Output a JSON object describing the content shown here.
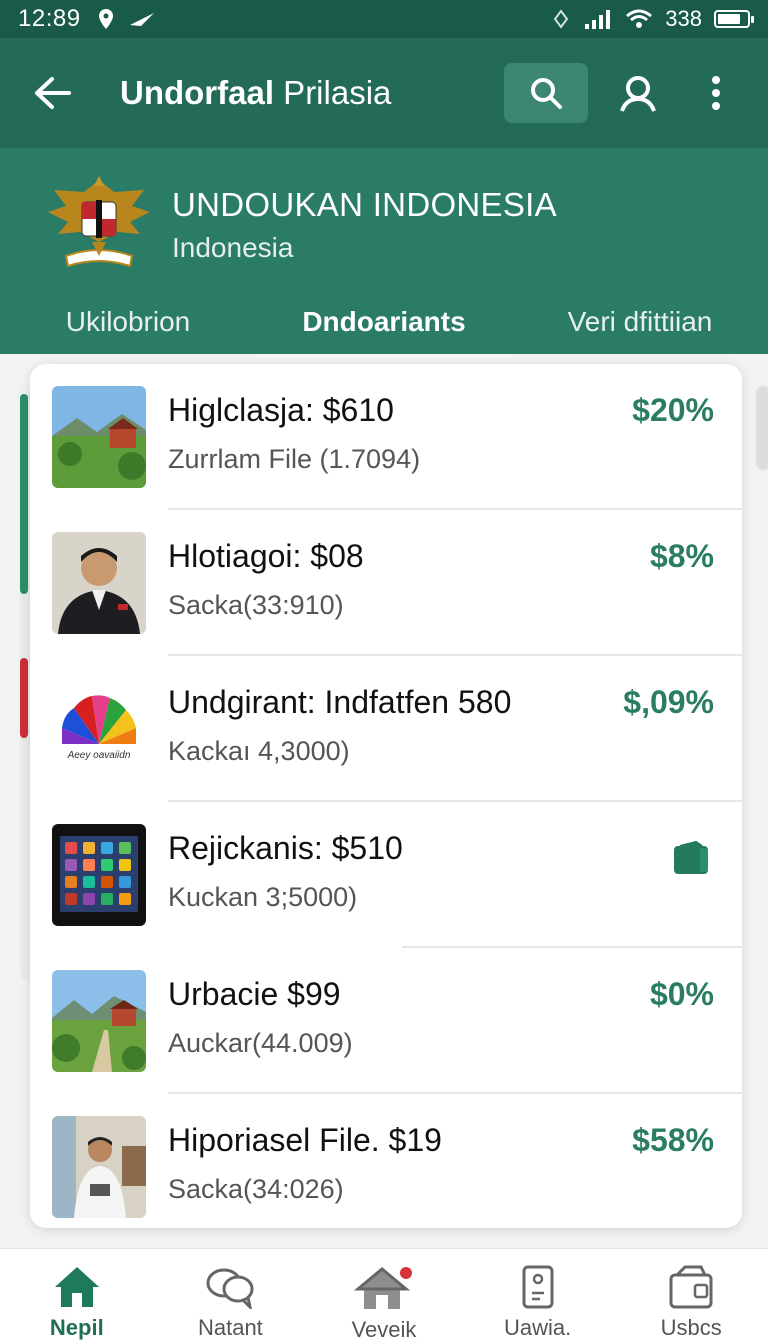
{
  "status_bar": {
    "time": "12:89",
    "battery_text": "338",
    "battery_level": 0.8
  },
  "app_bar": {
    "title_bold": "Undorfaal",
    "title_rest": " Prilasia"
  },
  "header": {
    "org_name": "UNDOUKAN INDONESIA",
    "org_sub": "Indonesia",
    "emblem_banner": "BHINEKA TUNGGAL IKA"
  },
  "tabs": [
    {
      "label": "Ukilobrion",
      "active": false
    },
    {
      "label": "Dndoariants",
      "active": true
    },
    {
      "label": "Veri dfittiian",
      "active": false
    }
  ],
  "list": [
    {
      "title": "Higlclasja: $610",
      "subtitle": "Zurrlam File (1.7094)",
      "value": "$20%",
      "thumb_icon": "landscape-thumbnail"
    },
    {
      "title": "Hlotiagoi: $08",
      "subtitle": "Sacka(33:910)",
      "value": "$8%",
      "thumb_icon": "portrait-thumbnail"
    },
    {
      "title": "Undgirant: Indfatfen 580",
      "subtitle": "Kackaı 4,3000)",
      "value": "$,09%",
      "thumb_icon": "color-fan-logo",
      "thumb_caption": "Aeey oavaiidn"
    },
    {
      "title": "Rejickanis: $510",
      "subtitle": "Kuckan 3;5000)",
      "value": "",
      "thumb_icon": "tablet-thumbnail",
      "trailing_icon": "wallet-icon"
    },
    {
      "title": "Urbacie $99",
      "subtitle": "Auckar(44.009)",
      "value": "$0%",
      "thumb_icon": "landscape-path-thumbnail"
    },
    {
      "title": "Hiporiasel File. $19",
      "subtitle": "Sacka(34:026)",
      "value": "$58%",
      "thumb_icon": "office-person-thumbnail"
    }
  ],
  "bottom_nav": [
    {
      "label": "Nepil",
      "icon": "home-icon",
      "active": true
    },
    {
      "label": "Natant",
      "icon": "chat-bubbles-icon",
      "active": false
    },
    {
      "label": "Veveik",
      "icon": "house-notification-icon",
      "active": false
    },
    {
      "label": "Uawia.",
      "icon": "phone-card-icon",
      "active": false
    },
    {
      "label": "Usbcs",
      "icon": "wallet-box-icon",
      "active": false
    }
  ],
  "colors": {
    "primary": "#236b58",
    "header": "#2b7c66",
    "accent_value": "#2a7d62",
    "status_bar": "#1a5a48"
  }
}
